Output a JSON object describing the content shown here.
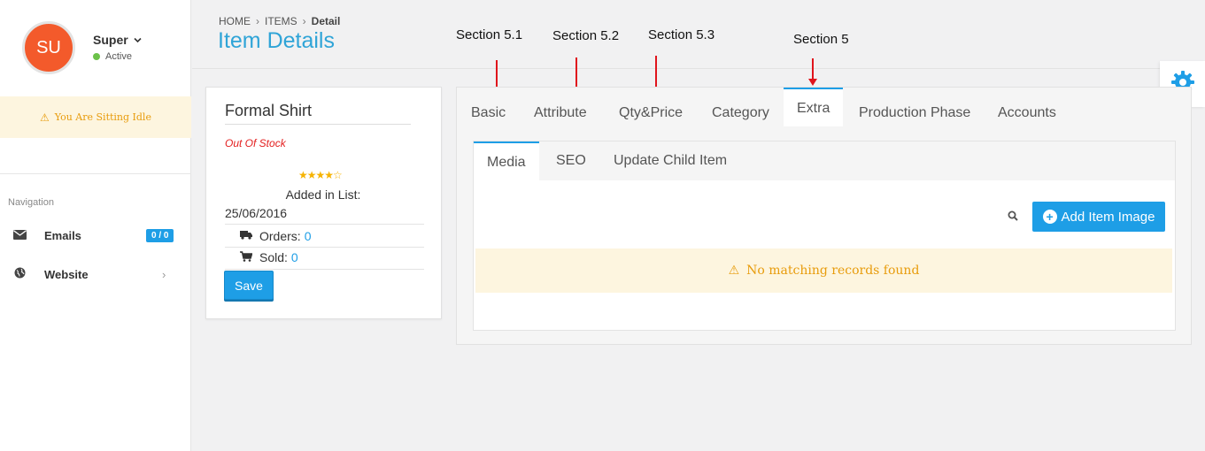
{
  "user": {
    "initials": "SU",
    "name": "Super",
    "name_chevron": "⌄",
    "status": "Active",
    "status_color": "#6cc24a"
  },
  "idle_banner": {
    "icon": "warning-icon",
    "text": "You Are Sitting Idle"
  },
  "navigation": {
    "heading": "Navigation",
    "items": [
      {
        "label": "Emails",
        "icon": "envelope-icon",
        "badge": "0 / 0"
      },
      {
        "label": "Website",
        "icon": "globe-icon",
        "chevron": "›"
      }
    ]
  },
  "breadcrumb": {
    "items": [
      "HOME",
      "ITEMS"
    ],
    "separator": "›",
    "current": "Detail"
  },
  "page_title": "Item Details",
  "annotations": [
    "Section 5.1",
    "Section 5.2",
    "Section 5.3",
    "Section 5"
  ],
  "product": {
    "name": "Formal Shirt",
    "stock_status": "Out Of Stock",
    "rating": 4,
    "rating_max": 5,
    "stars_text": "★★★★☆",
    "added_label": "Added in List:",
    "added_date": "25/06/2016",
    "orders_label": "Orders:",
    "orders_value": "0",
    "sold_label": "Sold:",
    "sold_value": "0",
    "save_label": "Save"
  },
  "tabs": [
    "Basic",
    "Attribute",
    "Qty&Price",
    "Category",
    "Extra",
    "Production Phase",
    "Accounts"
  ],
  "active_tab": "Extra",
  "sub_tabs": [
    "Media",
    "SEO",
    "Update Child Item"
  ],
  "active_sub_tab": "Media",
  "media": {
    "add_button_label": "Add Item Image",
    "empty_message": "No matching records found"
  },
  "colors": {
    "accent": "#1e9ee6",
    "title": "#2fa4d7",
    "warning": "#e89c0c",
    "danger": "#e31e1e",
    "avatar": "#f35a2b",
    "annotation_arrow": "#e0141c"
  }
}
